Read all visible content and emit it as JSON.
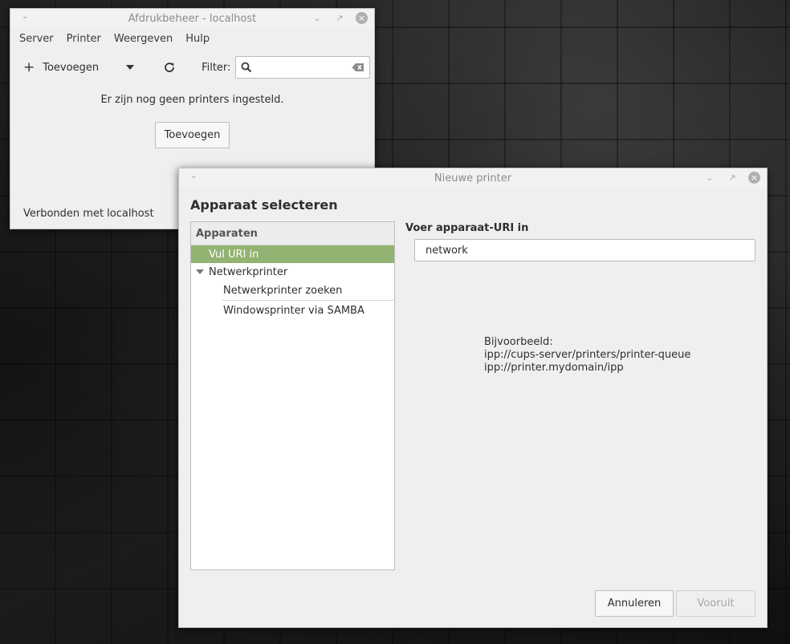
{
  "main_window": {
    "title": "Afdrukbeheer - localhost",
    "menu": [
      "Server",
      "Printer",
      "Weergeven",
      "Hulp"
    ],
    "toolbar": {
      "add_label": "Toevoegen",
      "filter_label": "Filter:",
      "filter_value": ""
    },
    "empty_message": "Er zijn nog geen printers ingesteld.",
    "add_button_label": "Toevoegen",
    "status": "Verbonden met localhost"
  },
  "dialog": {
    "title": "Nieuwe printer",
    "heading": "Apparaat selecteren",
    "devices_header": "Apparaten",
    "devices": {
      "selected": "Vul URI in",
      "group": "Netwerkprinter",
      "children": [
        "Netwerkprinter zoeken",
        "Windowsprinter via SAMBA"
      ]
    },
    "uri_label": "Voer apparaat-URI in",
    "uri_value": "network",
    "example_lines": [
      "Bijvoorbeeld:",
      "ipp://cups-server/printers/printer-queue",
      "ipp://printer.mydomain/ipp"
    ],
    "cancel_label": "Annuleren",
    "next_label": "Vooruit"
  },
  "colors": {
    "selection": "#92b372",
    "window_bg": "#efefef"
  }
}
